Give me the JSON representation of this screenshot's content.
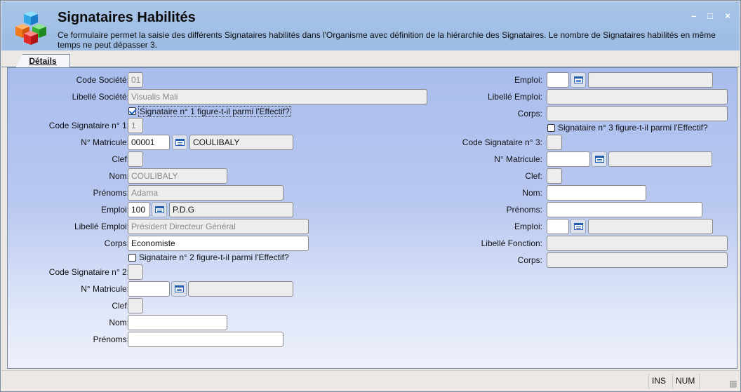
{
  "window": {
    "title": "Signataires Habilités",
    "description": "Ce formulaire permet la saisie des différents Signataires habilités dans l'Organisme avec définition de la hiérarchie des Signataires. Le nombre de Signataires habilités en même temps ne peut dépasser 3.",
    "controls": {
      "minimize": "–",
      "maximize": "□",
      "close": "×"
    }
  },
  "tabs": [
    {
      "label": "Détails"
    }
  ],
  "left": {
    "code_societe": {
      "label": "Code Société:",
      "value": "01"
    },
    "libelle_societe": {
      "label": "Libellé Société:",
      "value": "Visualis Mali"
    },
    "sig1_effectif": {
      "label": "Signataire n° 1 figure-t-il parmi l'Effectif?",
      "checked": true
    },
    "code_sig1": {
      "label": "Code Signataire n° 1:",
      "value": "1"
    },
    "matricule1": {
      "label": "N° Matricule:",
      "value": "00001",
      "name": "COULIBALY"
    },
    "clef1": {
      "label": "Clef:",
      "value": ""
    },
    "nom1": {
      "label": "Nom:",
      "value": "COULIBALY"
    },
    "prenoms1": {
      "label": "Prénoms:",
      "value": "Adama"
    },
    "emploi1": {
      "label": "Emploi:",
      "value": "100",
      "desc": "P.D.G"
    },
    "libelle_emploi1": {
      "label": "Libellé Emploi:",
      "value": "Président Directeur Général"
    },
    "corps1": {
      "label": "Corps:",
      "value": "Economiste"
    },
    "sig2_effectif": {
      "label": "Signataire n° 2 figure-t-il parmi l'Effectif?",
      "checked": false
    },
    "code_sig2": {
      "label": "Code Signataire n° 2:",
      "value": ""
    },
    "matricule2": {
      "label": "N° Matricule:",
      "value": "",
      "name": ""
    },
    "clef2": {
      "label": "Clef:",
      "value": ""
    },
    "nom2": {
      "label": "Nom:",
      "value": ""
    },
    "prenoms2": {
      "label": "Prénoms:",
      "value": ""
    }
  },
  "right": {
    "emploi2": {
      "label": "Emploi:",
      "value": "",
      "desc": ""
    },
    "libelle_emploi2": {
      "label": "Libellé Emploi:",
      "value": ""
    },
    "corps2": {
      "label": "Corps:",
      "value": ""
    },
    "sig3_effectif": {
      "label": "Signataire n° 3 figure-t-il parmi l'Effectif?",
      "checked": false
    },
    "code_sig3": {
      "label": "Code Signataire n° 3:",
      "value": ""
    },
    "matricule3": {
      "label": "N° Matricule:",
      "value": "",
      "name": ""
    },
    "clef3": {
      "label": "Clef:",
      "value": ""
    },
    "nom3": {
      "label": "Nom:",
      "value": ""
    },
    "prenoms3": {
      "label": "Prénoms:",
      "value": ""
    },
    "emploi3": {
      "label": "Emploi:",
      "value": "",
      "desc": ""
    },
    "libelle_fonction3": {
      "label": "Libellé Fonction:",
      "value": ""
    },
    "corps3": {
      "label": "Corps:",
      "value": ""
    }
  },
  "status": {
    "ins": "INS",
    "num": "NUM"
  },
  "icons": {
    "app": "cubes-icon",
    "lookup": "list-lookup-icon"
  }
}
